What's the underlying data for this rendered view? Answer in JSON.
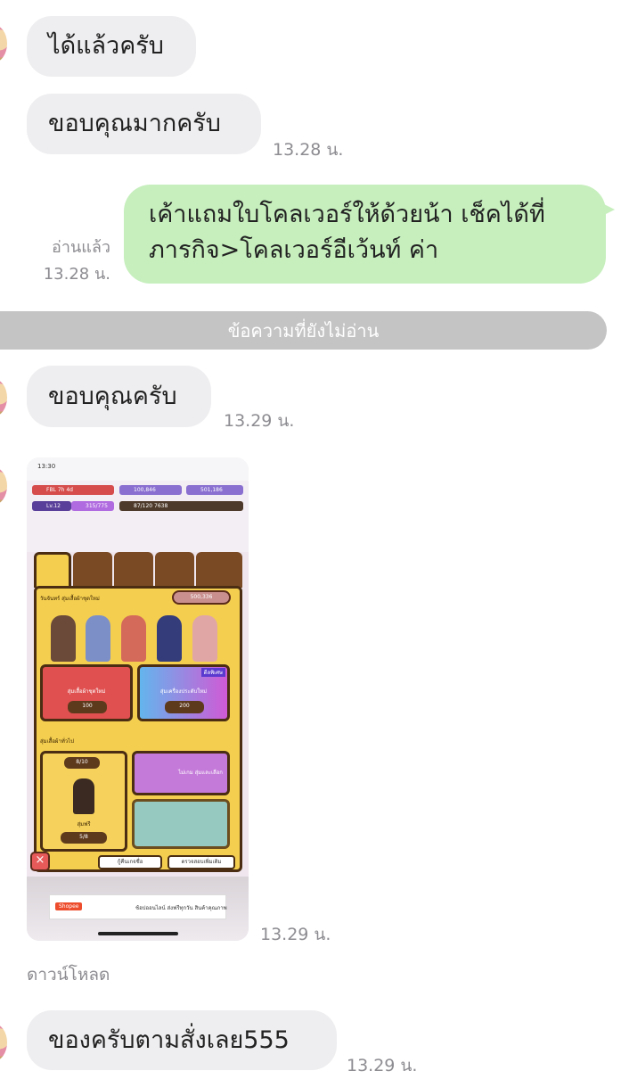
{
  "messages": [
    {
      "text": "ได้แล้วครับ"
    },
    {
      "text": "ขอบคุณมากครับ",
      "time": "13.28 น."
    },
    {
      "text_line1": "เค้าแถมใบโคลเวอร์ให้ด้วยน้า เช็คได้ที่",
      "text_line2": "ภารกิจ>โคลเวอร์อีเว้นท์ ค่า",
      "read_label": "อ่านแล้ว",
      "time": "13.28 น."
    },
    {
      "text": "ขอบคุณครับ",
      "time": "13.29 น."
    },
    {
      "time": "13.29 น.",
      "download_label": "ดาวน์โหลด"
    },
    {
      "text": "ของครับตามสั่งเลย555",
      "time": "13.29 น."
    }
  ],
  "unread_divider": "ข้อความที่ยังไม่อ่าน",
  "game_screenshot": {
    "status_time": "13:30",
    "bar_1": "FBL 7h 4d",
    "bar_2": "100,846",
    "bar_3": "501,186",
    "bar_4": "Lv.12",
    "bar_5": "315/775",
    "bar_6": "87/120 7638",
    "panel_title": "วันจันทร์ สุ่มเสื้อผ้าชุดใหม่",
    "currency": "500,336",
    "card_red_label": "สุ่มเสื้อผ้าชุดใหม่",
    "card_red_price": "100",
    "card_purple_badge": "ดีลพิเศษ",
    "card_purple_label": "สุ่มเครื่องประดับใหม่",
    "card_purple_price": "200",
    "section_2_title": "สุ่มเสื้อผ้าทั่วไป",
    "counter": "8/10",
    "char_label": "สุ่มฟรี",
    "char_price": "5/8",
    "promo_label": "ไม่เกม สุ่มและเลือก",
    "bottom_btn_1": "กู้คืนเกจชื่อ",
    "bottom_btn_2": "ตรวจสอบเพิ่มเติม",
    "ad_brand": "Shopee",
    "ad_text": "ช้อปออนไลน์ ส่งฟรีทุกวัน สินค้าคุณภาพ"
  },
  "colors": {
    "sent_bubble": "#c6efbd",
    "received_bubble": "#eeeef0",
    "divider": "#c4c4c4",
    "time": "#8d8d92"
  }
}
